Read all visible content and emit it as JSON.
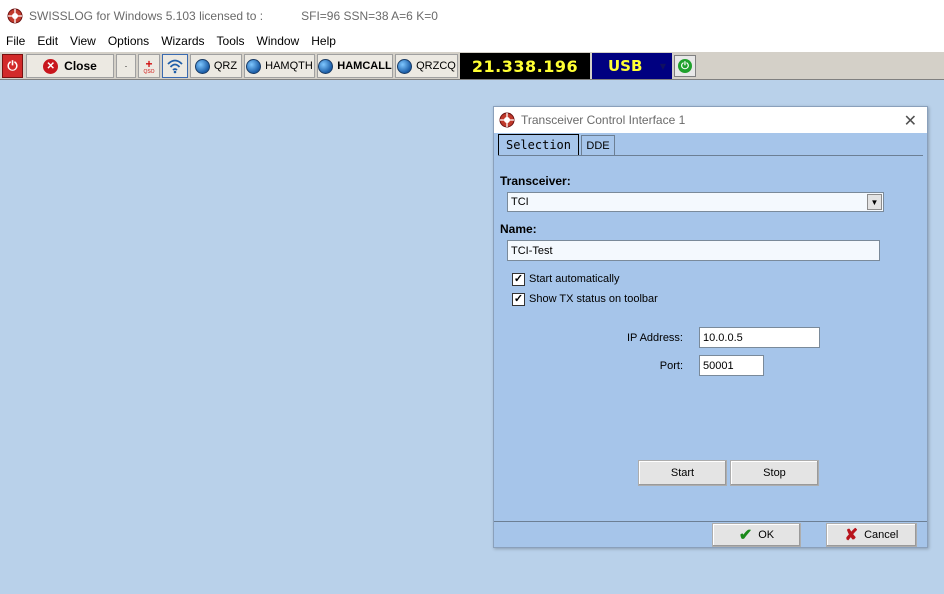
{
  "window": {
    "title_app": "SWISSLOG for Windows 5.103 licensed to :",
    "title_status": "SFI=96 SSN=38 A=6 K=0"
  },
  "menu": [
    "File",
    "Edit",
    "View",
    "Options",
    "Wizards",
    "Tools",
    "Window",
    "Help"
  ],
  "toolbar": {
    "close_label": "Close",
    "qso_badge": "QSO",
    "qrz_label": "QRZ",
    "hamqth_label": "HAMQTH",
    "hamcall_label": "HAMCALL",
    "qrzcq_label": "QRZCQ",
    "frequency": "21.338.196",
    "mode": "USB",
    "freq_color": "#ffff33",
    "mode_bg_color": "#000080"
  },
  "dialog": {
    "title": "Transceiver Control Interface 1",
    "tabs": [
      "Selection",
      "DDE"
    ],
    "active_tab": "Selection",
    "transceiver_label": "Transceiver:",
    "transceiver_value": "TCI",
    "name_label": "Name:",
    "name_value": "TCI-Test",
    "start_auto_label": "Start automatically",
    "start_auto_checked": true,
    "show_tx_label": "Show TX status on toolbar",
    "show_tx_checked": true,
    "ip_label": "IP Address:",
    "ip_value": "10.0.0.5",
    "port_label": "Port:",
    "port_value": "50001",
    "start_button": "Start",
    "stop_button": "Stop",
    "ok_button": "OK",
    "cancel_button": "Cancel"
  },
  "colors": {
    "desktop_bg": "#b9d1ea",
    "dialog_bg": "#a6c5ea"
  }
}
